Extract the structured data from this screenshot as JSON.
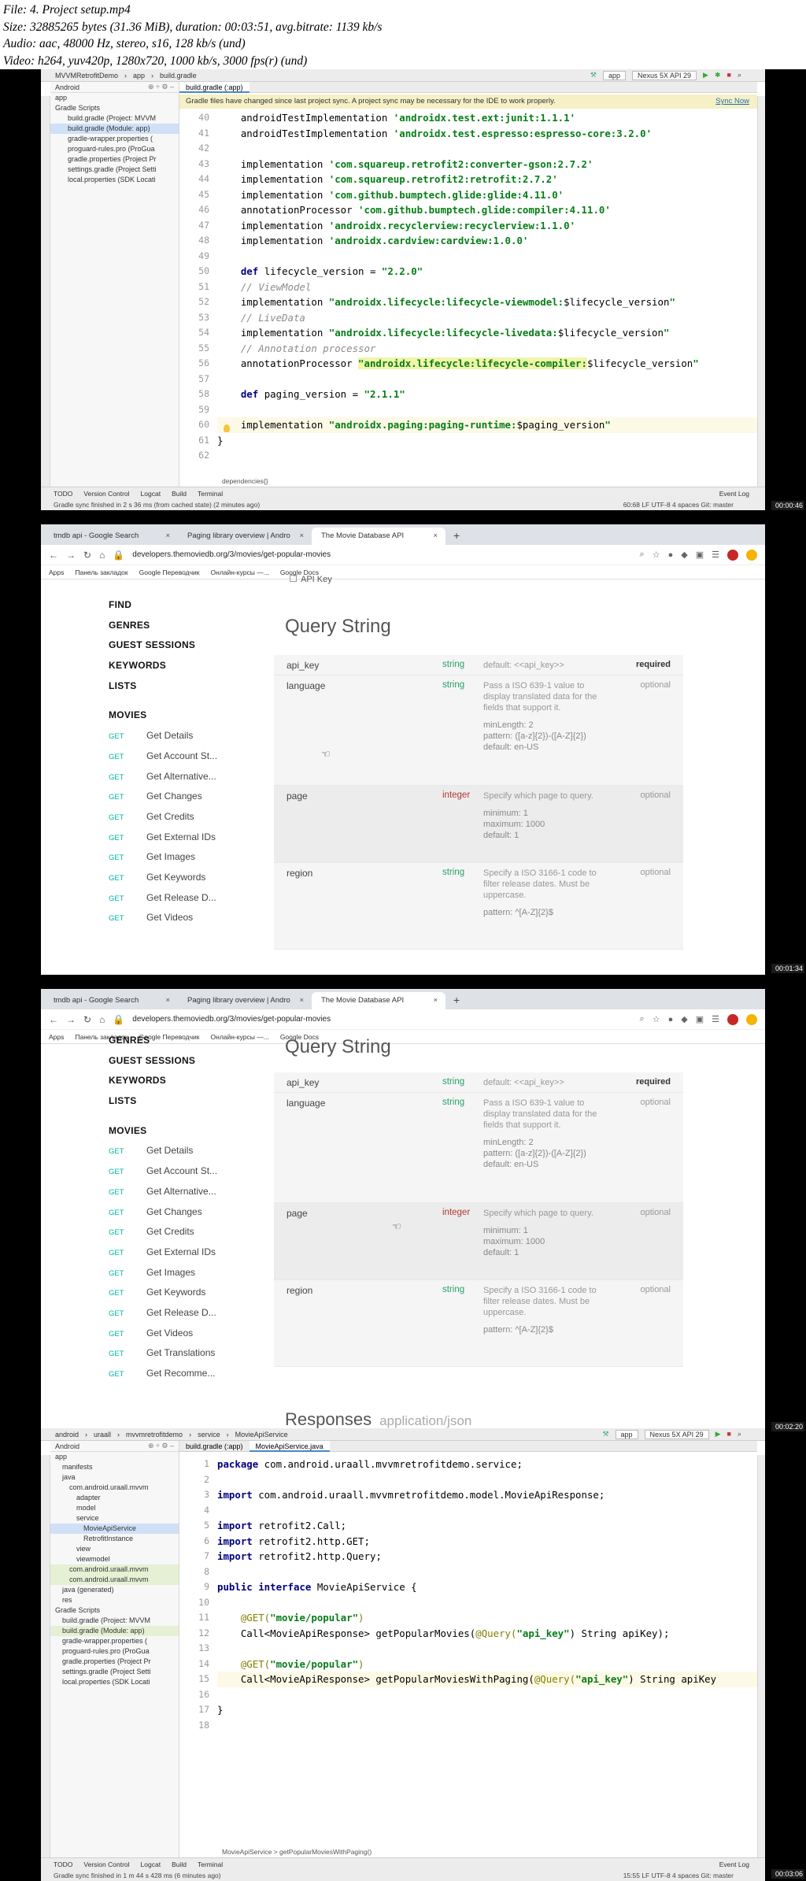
{
  "header_lines": [
    "File: 4. Project setup.mp4",
    "Size: 32885265 bytes (31.36 MiB), duration: 00:03:51, avg.bitrate: 1139 kb/s",
    "Audio: aac, 48000 Hz, stereo, s16, 128 kb/s (und)",
    "Video: h264, yuv420p, 1280x720, 1000 kb/s, 3000 fps(r) (und)"
  ],
  "timestamps": [
    "00:00:46",
    "00:01:34",
    "00:02:20",
    "00:03:06"
  ],
  "ide1": {
    "project": "MVVMRetrofitDemo",
    "crumb_app": "app",
    "crumb_file": "build.gradle",
    "run_config": "app",
    "device": "Nexus 5X API 29",
    "view_mode": "Android",
    "tab": "build.gradle (:app)",
    "banner": "Gradle files have changed since last project sync. A project sync may be necessary for the IDE to work properly.",
    "sync_now": "Sync Now",
    "tree": [
      "app",
      "Gradle Scripts",
      "build.gradle (Project: MVVM",
      "build.gradle (Module: app)",
      "gradle-wrapper.properties (",
      "proguard-rules.pro (ProGua",
      "gradle.properties (Project Pr",
      "settings.gradle (Project Setti",
      "local.properties (SDK Locati"
    ],
    "line_numbers": [
      "40",
      "41",
      "42",
      "43",
      "44",
      "45",
      "46",
      "47",
      "48",
      "49",
      "50",
      "51",
      "52",
      "53",
      "54",
      "55",
      "56",
      "57",
      "58",
      "59",
      "60",
      "61",
      "62"
    ],
    "breadcrumb_bottom": "dependencies{}",
    "bottom_tools": [
      "TODO",
      "Version Control",
      "Logcat",
      "Build",
      "Terminal"
    ],
    "event_log": "Event Log",
    "status_msg": "Gradle sync finished in 2 s 36 ms (from cached state) (2 minutes ago)",
    "status_right": "60:68  LF  UTF-8  4 spaces  Git: master"
  },
  "code1": [
    [
      [
        "    androidTestImplementation ",
        "p"
      ],
      [
        "'androidx.test.ext:junit:1.1.1'",
        "s"
      ]
    ],
    [
      [
        "    androidTestImplementation ",
        "p"
      ],
      [
        "'androidx.test.espresso:espresso-core:3.2.0'",
        "s"
      ]
    ],
    [
      [
        "",
        ""
      ]
    ],
    [
      [
        "    implementation ",
        "p"
      ],
      [
        "'com.squareup.retrofit2:converter-gson:2.7.2'",
        "s"
      ]
    ],
    [
      [
        "    implementation ",
        "p"
      ],
      [
        "'com.squareup.retrofit2:retrofit:2.7.2'",
        "s"
      ]
    ],
    [
      [
        "    implementation ",
        "p"
      ],
      [
        "'com.github.bumptech.glide:glide:4.11.0'",
        "s"
      ]
    ],
    [
      [
        "    annotationProcessor ",
        "p"
      ],
      [
        "'com.github.bumptech.glide:compiler:4.11.0'",
        "s"
      ]
    ],
    [
      [
        "    implementation ",
        "p"
      ],
      [
        "'androidx.recyclerview:recyclerview:1.1.0'",
        "s"
      ]
    ],
    [
      [
        "    implementation ",
        "p"
      ],
      [
        "'androidx.cardview:cardview:1.0.0'",
        "s"
      ]
    ],
    [
      [
        "",
        ""
      ]
    ],
    [
      [
        "    ",
        "p"
      ],
      [
        "def",
        "k"
      ],
      [
        " lifecycle_version = ",
        "p"
      ],
      [
        "\"2.2.0\"",
        "s"
      ]
    ],
    [
      [
        "    // ViewModel",
        "c"
      ]
    ],
    [
      [
        "    implementation ",
        "p"
      ],
      [
        "\"androidx.lifecycle:lifecycle-viewmodel:",
        "s"
      ],
      [
        "$lifecycle_version",
        "p"
      ],
      [
        "\"",
        "s"
      ]
    ],
    [
      [
        "    // LiveData",
        "c"
      ]
    ],
    [
      [
        "    implementation ",
        "p"
      ],
      [
        "\"androidx.lifecycle:lifecycle-livedata:",
        "s"
      ],
      [
        "$lifecycle_version",
        "p"
      ],
      [
        "\"",
        "s"
      ]
    ],
    [
      [
        "    // Annotation processor",
        "c"
      ]
    ],
    [
      [
        "    annotationProcessor ",
        "p"
      ],
      [
        "\"androidx.lifecycle:lifecycle-compiler:",
        "s"
      ],
      [
        "$lifecycle_version",
        "p"
      ],
      [
        "\"",
        "s"
      ]
    ],
    [
      [
        "",
        ""
      ]
    ],
    [
      [
        "    ",
        "p"
      ],
      [
        "def",
        "k"
      ],
      [
        " paging_version = ",
        "p"
      ],
      [
        "\"2.1.1\"",
        "s"
      ]
    ],
    [
      [
        "",
        ""
      ]
    ],
    [
      [
        "    implementation ",
        "p"
      ],
      [
        "\"androidx.paging:paging-runtime:",
        "s"
      ],
      [
        "$paging_version",
        "p"
      ],
      [
        "\"",
        "s"
      ]
    ],
    [
      [
        "}",
        "p"
      ]
    ],
    [
      [
        "",
        ""
      ]
    ]
  ],
  "browser": {
    "tabs": [
      "tmdb api - Google Search",
      "Paging library overview | Andro",
      "The Movie Database API"
    ],
    "url": "developers.themoviedb.org/3/movies/get-popular-movies",
    "bookmarks": [
      "Apps",
      "Панель закладок",
      "Google Переводчик",
      "Онлайн-курсы —...",
      "Google Docs"
    ],
    "api_key_label": "API Key",
    "nav_sections": [
      "FIND",
      "GENRES",
      "GUEST SESSIONS",
      "KEYWORDS",
      "LISTS"
    ],
    "movies_label": "MOVIES",
    "get_label": "GET",
    "endpoints": [
      "Get Details",
      "Get Account St...",
      "Get Alternative...",
      "Get Changes",
      "Get Credits",
      "Get External IDs",
      "Get Images",
      "Get Keywords",
      "Get Release D...",
      "Get Videos",
      "Get Translations",
      "Get Recomme..."
    ],
    "query_title": "Query String",
    "responses_title": "Responses",
    "responses_type": "application/json",
    "params": [
      {
        "name": "api_key",
        "type": "string",
        "desc": "default: <<api_key>>",
        "req": "required"
      },
      {
        "name": "language",
        "type": "string",
        "desc": "Pass a ISO 639-1 value to display translated data for the fields that support it.",
        "extra": [
          "minLength: 2",
          "pattern: ([a-z]{2})-([A-Z]{2})",
          "default: en-US"
        ],
        "req": "optional"
      },
      {
        "name": "page",
        "type": "integer",
        "desc": "Specify which page to query.",
        "extra": [
          "minimum: 1",
          "maximum: 1000",
          "default: 1"
        ],
        "req": "optional"
      },
      {
        "name": "region",
        "type": "string",
        "desc": "Specify a ISO 3166-1 code to filter release dates. Must be uppercase.",
        "extra": [
          "pattern: ^[A-Z]{2}$"
        ],
        "req": "optional"
      }
    ]
  },
  "ide2": {
    "crumbs": [
      "android",
      "uraall",
      "mvvmretrofitdemo",
      "service",
      "MovieApiService"
    ],
    "run_config": "app",
    "device": "Nexus 5X API 29",
    "view_mode": "Android",
    "tabs": [
      "build.gradle (:app)",
      "MovieApiService.java"
    ],
    "tree": [
      "app",
      "manifests",
      "java",
      "com.android.uraall.mvvm",
      "adapter",
      "model",
      "service",
      "MovieApiService",
      "RetrofitInstance",
      "view",
      "viewmodel",
      "com.android.uraall.mvvm",
      "com.android.uraall.mvvm",
      "java (generated)",
      "res",
      "Gradle Scripts",
      "build.gradle (Project: MVVM",
      "build.gradle (Module: app)",
      "gradle-wrapper.properties (",
      "proguard-rules.pro (ProGua",
      "gradle.properties (Project Pr",
      "settings.gradle (Project Setti",
      "local.properties (SDK Locati"
    ],
    "line_numbers": [
      "1",
      "2",
      "3",
      "4",
      "5",
      "6",
      "7",
      "8",
      "9",
      "10",
      "11",
      "12",
      "13",
      "14",
      "15",
      "16",
      "17",
      "18"
    ],
    "breadcrumb_bottom": "MovieApiService  >  getPopularMoviesWithPaging()",
    "bottom_tools": [
      "TODO",
      "Version Control",
      "Logcat",
      "Build",
      "Terminal"
    ],
    "event_log": "Event Log",
    "status_msg": "Gradle sync finished in 1 m 44 s 428 ms (6 minutes ago)",
    "status_right": "15:55  LF  UTF-8  4 spaces  Git: master"
  },
  "code2": [
    [
      [
        "package",
        "k"
      ],
      [
        " com.android.uraall.mvvmretrofitdemo.service;",
        "p"
      ]
    ],
    [
      [
        "",
        ""
      ]
    ],
    [
      [
        "import",
        "k"
      ],
      [
        " com.android.uraall.mvvmretrofitdemo.model.MovieApiResponse;",
        "p"
      ]
    ],
    [
      [
        "",
        ""
      ]
    ],
    [
      [
        "import",
        "k"
      ],
      [
        " retrofit2.Call;",
        "p"
      ]
    ],
    [
      [
        "import",
        "k"
      ],
      [
        " retrofit2.http.GET;",
        "p"
      ]
    ],
    [
      [
        "import",
        "k"
      ],
      [
        " retrofit2.http.Query;",
        "p"
      ]
    ],
    [
      [
        "",
        ""
      ]
    ],
    [
      [
        "public interface",
        "k"
      ],
      [
        " MovieApiService {",
        "p"
      ]
    ],
    [
      [
        "",
        ""
      ]
    ],
    [
      [
        "    @GET(",
        "a"
      ],
      [
        "\"movie/popular\"",
        "s"
      ],
      [
        ")",
        "a"
      ]
    ],
    [
      [
        "    Call<MovieApiResponse> getPopularMovies(",
        "p"
      ],
      [
        "@Query(",
        "a"
      ],
      [
        "\"api_key\"",
        "s"
      ],
      [
        ") String apiKey);",
        "p"
      ]
    ],
    [
      [
        "",
        ""
      ]
    ],
    [
      [
        "    @GET(",
        "a"
      ],
      [
        "\"movie/popular\"",
        "s"
      ],
      [
        ")",
        "a"
      ]
    ],
    [
      [
        "    Call<MovieApiResponse> getPopularMoviesWithPaging(",
        "p"
      ],
      [
        "@Query(",
        "a"
      ],
      [
        "\"api_key\"",
        "s"
      ],
      [
        ") String apiKey",
        "p"
      ]
    ],
    [
      [
        "",
        ""
      ]
    ],
    [
      [
        "}",
        "p"
      ]
    ],
    [
      [
        "",
        ""
      ]
    ]
  ]
}
